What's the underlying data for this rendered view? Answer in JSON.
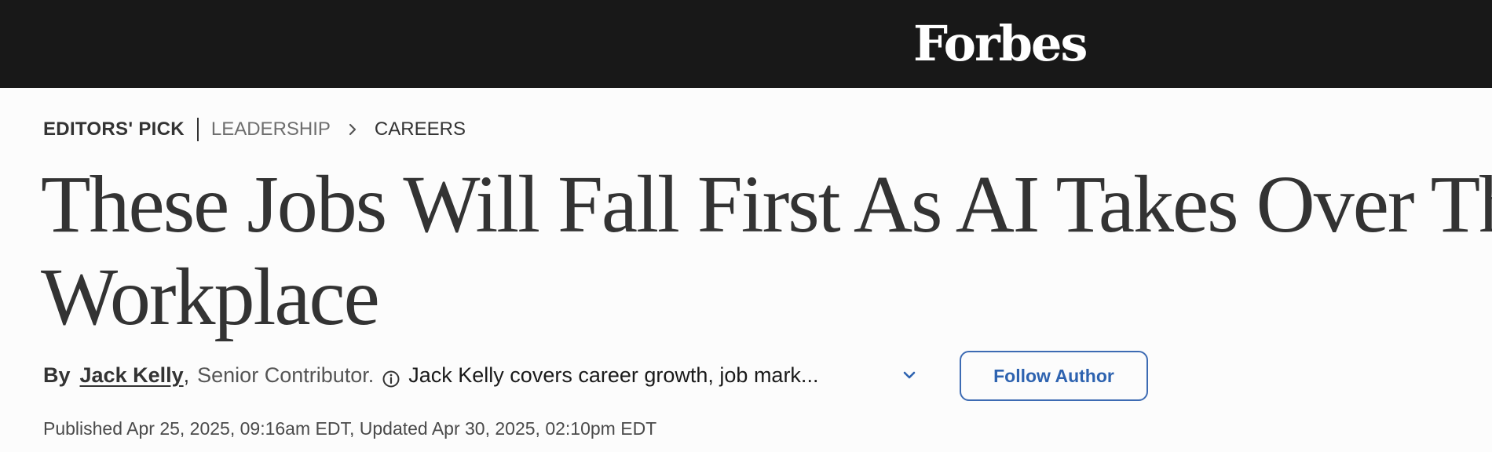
{
  "header": {
    "logo_text": "Forbes",
    "background_color": "#181818"
  },
  "breadcrumb": {
    "badge": "EDITORS' PICK",
    "section": "LEADERSHIP",
    "separator_icon": "chevron-right-icon",
    "subsection": "CAREERS"
  },
  "article": {
    "headline_line1": "These Jobs Will Fall First As AI Takes Over The",
    "headline_line2": "Workplace"
  },
  "byline": {
    "prefix": "By",
    "author_name": "Jack Kelly",
    "comma": ",",
    "author_role": "Senior Contributor.",
    "info_icon": "info-circle-icon",
    "author_bio": "Jack Kelly covers career growth, job mark...",
    "expand_icon": "chevron-down-icon",
    "follow_label": "Follow Author",
    "accent_color": "#2e63b0"
  },
  "dates": {
    "text": "Published Apr 25, 2025, 09:16am EDT, Updated Apr 30, 2025, 02:10pm EDT"
  }
}
